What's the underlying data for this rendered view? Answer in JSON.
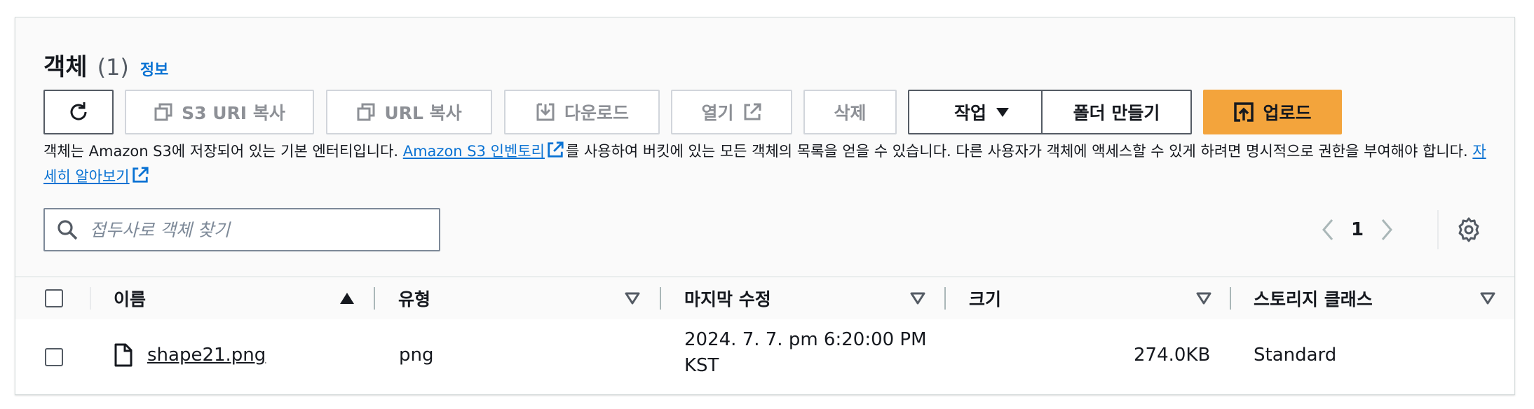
{
  "header": {
    "title": "객체",
    "count": "(1)",
    "info": "정보"
  },
  "toolbar": {
    "refresh_aria": "새로 고침",
    "copy_s3_uri": "S3 URI 복사",
    "copy_url": "URL 복사",
    "download": "다운로드",
    "open": "열기",
    "delete": "삭제",
    "actions": "작업",
    "create_folder": "폴더 만들기",
    "upload": "업로드"
  },
  "description": {
    "part1": "객체는 Amazon S3에 저장되어 있는 기본 엔터티입니다. ",
    "inventory_link": "Amazon S3 인벤토리",
    "part2": "를 사용하여 버킷에 있는 모든 객체의 목록을 얻을 수 있습니다. 다른 사용자가 객체에 액세스할 수 있게 하려면 명시적으로 권한을 부여해야 합니다. ",
    "learn_more": "자세히 알아보기"
  },
  "search": {
    "placeholder": "접두사로 객체 찾기",
    "value": ""
  },
  "pagination": {
    "current_page": "1"
  },
  "table": {
    "columns": [
      "이름",
      "유형",
      "마지막 수정",
      "크기",
      "스토리지 클래스"
    ],
    "rows": [
      {
        "name": "shape21.png",
        "type": "png",
        "modified_line1": "2024. 7. 7. pm 6:20:00 PM",
        "modified_line2": "KST",
        "size": "274.0KB",
        "storage_class": "Standard"
      }
    ]
  },
  "colors": {
    "accent": "#0972d3",
    "primary_button": "#f3a43c",
    "border": "#d5dbdb"
  },
  "icons": [
    "refresh-icon",
    "copy-icon",
    "download-icon",
    "external-link-icon",
    "caret-down-icon",
    "upload-icon",
    "search-icon",
    "chevron-left-icon",
    "chevron-right-icon",
    "gear-icon",
    "sort-ascending-icon",
    "sort-icon",
    "file-icon"
  ]
}
